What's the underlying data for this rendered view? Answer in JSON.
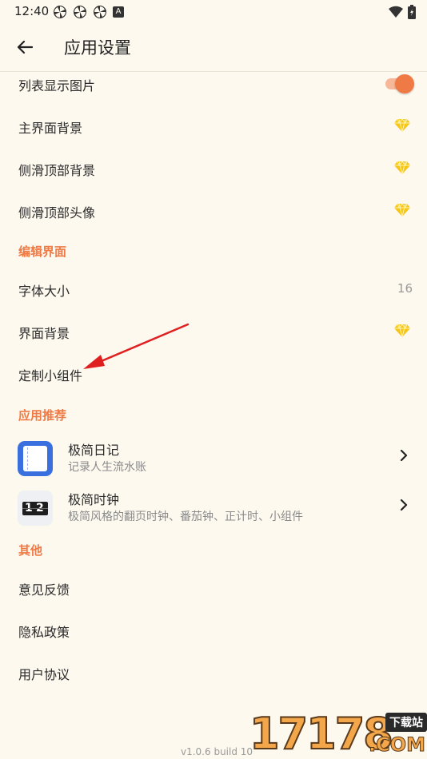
{
  "status_bar": {
    "time": "12:40",
    "notif_badge": "A"
  },
  "app_bar": {
    "title": "应用设置"
  },
  "rows": {
    "list_show_image": "列表显示图片",
    "main_bg": "主界面背景",
    "drawer_top_bg": "侧滑顶部背景",
    "drawer_top_avatar": "侧滑顶部头像",
    "font_size": "字体大小",
    "font_size_value": "16",
    "editor_bg": "界面背景",
    "custom_widget": "定制小组件",
    "feedback": "意见反馈",
    "privacy": "隐私政策",
    "user_agreement": "用户协议"
  },
  "sections": {
    "edit_ui": "编辑界面",
    "app_recommend": "应用推荐",
    "other": "其他"
  },
  "apps": [
    {
      "name": "极简日记",
      "desc": "记录人生流水账"
    },
    {
      "name": "极简时钟",
      "desc": "极简风格的翻页时钟、番茄钟、正计时、小组件"
    }
  ],
  "clock_icon_digits": {
    "a": "1",
    "b": "2"
  },
  "version": "v1.0.6 build 10",
  "watermark": {
    "digits": "17178",
    "badge": "下载站",
    "suffix": ".COM"
  },
  "toggle_list_show_image": 1,
  "colors": {
    "accent": "#f07a45",
    "premium": "#f5c518",
    "background": "#fdf9ef",
    "diary_blue": "#3a6fe0"
  },
  "icons": [
    "back-arrow-icon",
    "diamond-icon",
    "chevron-right-icon",
    "wifi-icon",
    "battery-icon"
  ]
}
